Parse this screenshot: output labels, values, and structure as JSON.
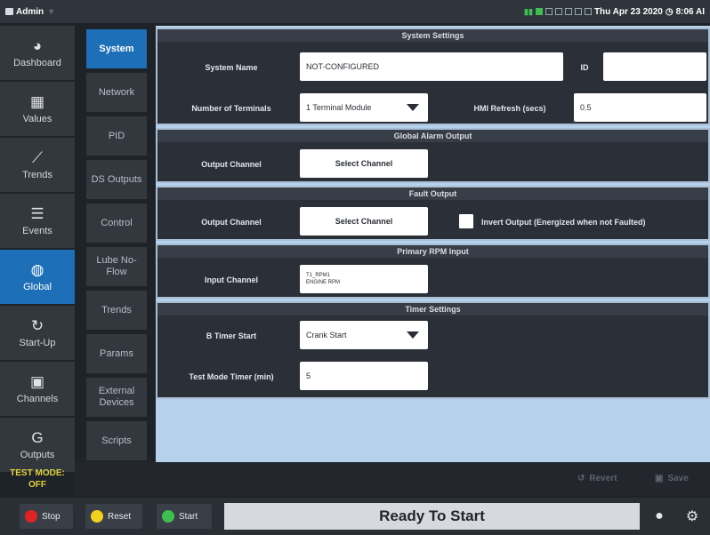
{
  "status_bar": {
    "user": "Admin",
    "datetime": "Thu Apr 23 2020",
    "time": "8:06 AI"
  },
  "nav": {
    "items": [
      {
        "label": "Dashboard",
        "icon": "gauge-icon",
        "glyph": "◕"
      },
      {
        "label": "Values",
        "icon": "grid-icon",
        "glyph": "▦"
      },
      {
        "label": "Trends",
        "icon": "line-chart-icon",
        "glyph": "⟋"
      },
      {
        "label": "Events",
        "icon": "list-icon",
        "glyph": "☰"
      },
      {
        "label": "Global",
        "icon": "globe-icon",
        "glyph": "◍"
      },
      {
        "label": "Start-Up",
        "icon": "refresh-icon",
        "glyph": "↻"
      },
      {
        "label": "Channels",
        "icon": "chip-icon",
        "glyph": "▣"
      },
      {
        "label": "Outputs",
        "icon": "output-icon",
        "glyph": "G"
      }
    ],
    "active": "Global",
    "test_mode_label": "TEST MODE:",
    "test_mode_value": "OFF"
  },
  "subnav": {
    "items": [
      "System",
      "Network",
      "PID",
      "DS Outputs",
      "Control",
      "Lube No-Flow",
      "Trends",
      "Params",
      "External Devices",
      "Scripts"
    ],
    "active": "System"
  },
  "system_settings": {
    "title": "System Settings",
    "system_name_label": "System Name",
    "system_name_value": "NOT-CONFIGURED",
    "id_label": "ID",
    "id_value": "",
    "terminals_label": "Number of Terminals",
    "terminals_value": "1 Terminal Module",
    "hmi_refresh_label": "HMI Refresh (secs)",
    "hmi_refresh_value": "0.5"
  },
  "global_alarm_output": {
    "title": "Global Alarm Output",
    "output_channel_label": "Output Channel",
    "select_channel_label": "Select Channel"
  },
  "fault_output": {
    "title": "Fault Output",
    "output_channel_label": "Output Channel",
    "select_channel_label": "Select Channel",
    "invert_output_label": "Invert Output (Energized when not Faulted)",
    "invert_output_checked": false
  },
  "primary_rpm_input": {
    "title": "Primary RPM Input",
    "input_channel_label": "Input Channel",
    "input_channel_line1": "T1_RPM1",
    "input_channel_line2": "ENGINE RPM"
  },
  "timer_settings": {
    "title": "Timer Settings",
    "b_timer_label": "B Timer Start",
    "b_timer_value": "Crank Start",
    "test_mode_timer_label": "Test Mode Timer (min)",
    "test_mode_timer_value": "5"
  },
  "actions": {
    "revert_label": "Revert",
    "save_label": "Save"
  },
  "controls": {
    "stop_label": "Stop",
    "reset_label": "Reset",
    "start_label": "Start",
    "status_text": "Ready To Start"
  },
  "colors": {
    "accent": "#1d6fb8",
    "panel_bg": "#b6d1ec",
    "stop": "#e02424",
    "reset": "#f0d21e",
    "start": "#3fbf4f"
  }
}
